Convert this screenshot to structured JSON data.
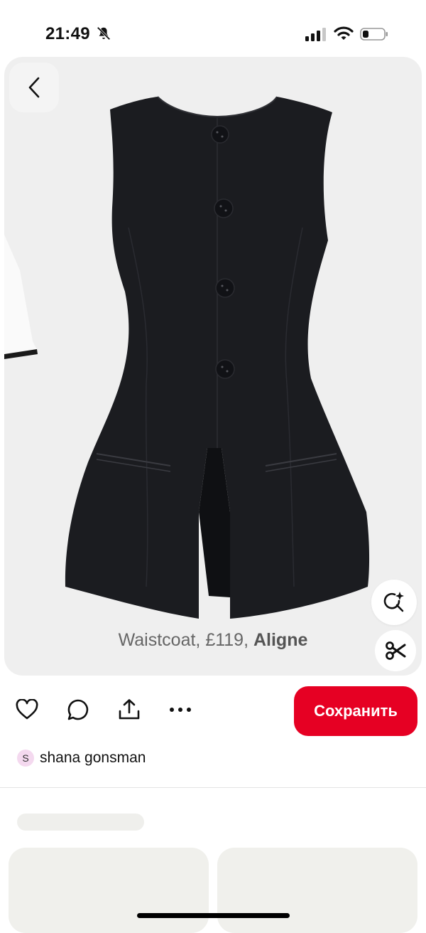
{
  "status_bar": {
    "time": "21:49"
  },
  "pin": {
    "caption_text": "Waistcoat, £119, ",
    "caption_brand": "Aligne",
    "image_subject": "black sleeveless waistcoat"
  },
  "actions": {
    "save_label": "Сохранить"
  },
  "author": {
    "initial": "S",
    "name": "shana gonsman"
  },
  "colors": {
    "save_button": "#e60023",
    "avatar_bg": "#f4d9ef",
    "card_bg": "#efefef"
  },
  "icons": [
    "bell-slash-icon",
    "signal-icon",
    "wifi-icon",
    "battery-icon",
    "back-chevron-icon",
    "visual-search-icon",
    "scissors-icon",
    "heart-icon",
    "comment-icon",
    "share-icon",
    "more-icon"
  ]
}
